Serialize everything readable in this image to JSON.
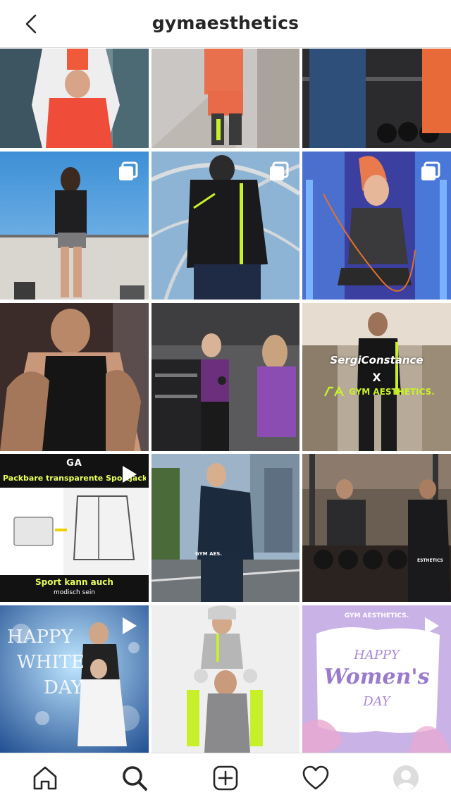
{
  "header": {
    "title": "gymaesthetics",
    "back_icon": "chevron-left-icon"
  },
  "tiles": {
    "t7": {
      "line1": "SergiConstance",
      "line2": "X",
      "brand": "GYM AESTHETICS."
    },
    "t9": {
      "logo": "GA",
      "caption_top": "Packbare transparente Sportjacke",
      "caption_bottom": "Sport kann auch",
      "caption_bottom2": "modisch sein"
    },
    "t10": {
      "shirt_text": "GYM AES."
    },
    "t11": {
      "shirt_text": "ESTHETICS"
    },
    "t12": {
      "line1": "HAPPY",
      "line2": "WHITE",
      "line3": "DAY"
    },
    "t14": {
      "brand": "GYM AESTHETICS.",
      "line1": "HAPPY",
      "line2": "Women's",
      "line3": "DAY"
    }
  },
  "bottom_nav": {
    "items": [
      "home-icon",
      "search-icon",
      "new-post-icon",
      "activity-heart-icon",
      "profile-avatar"
    ]
  },
  "colors": {
    "accent_lime": "#c8f02a",
    "divider": "#dbdbdb",
    "text": "#262626",
    "lavender": "#c9b2e6"
  }
}
